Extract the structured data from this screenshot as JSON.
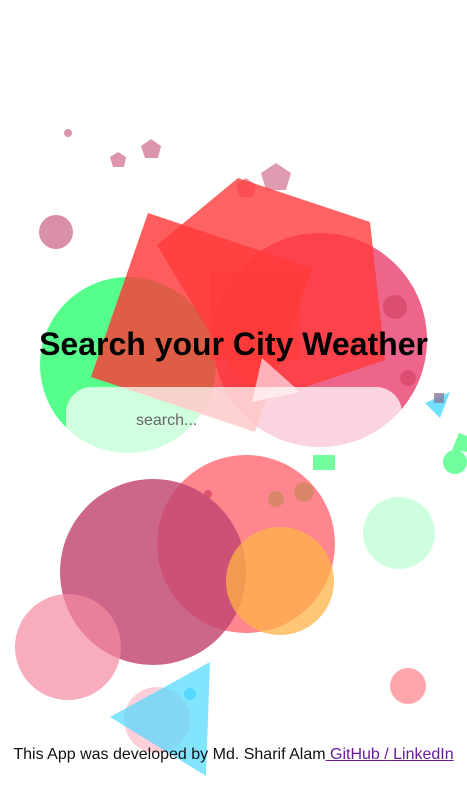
{
  "header": {
    "title": "Search your City Weather"
  },
  "search": {
    "placeholder": "search..."
  },
  "footer": {
    "credit": "This App was developed by Md. Sharif Alam",
    "github_label": " GitHub ",
    "separator": "/",
    "linkedin_label": " LinkedIn"
  },
  "colors": {
    "red": "#ff3b3b",
    "pink": "#f06b8a",
    "green": "#4dff85",
    "mauve": "#c94c73",
    "orange": "#ffb347",
    "cyan": "#4fd8ff"
  }
}
